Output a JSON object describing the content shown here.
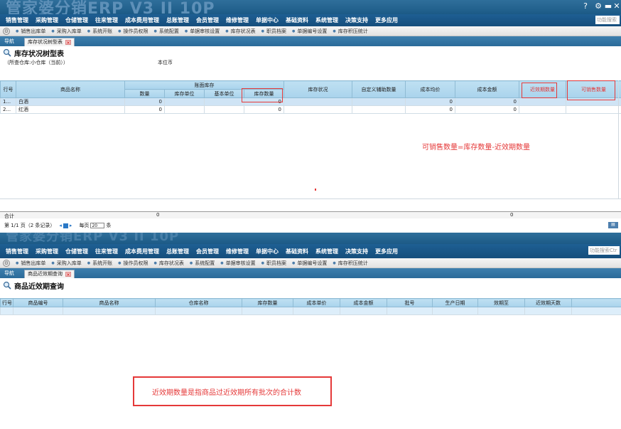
{
  "app": {
    "brand": "管家婆分销ERP V3 II 10P"
  },
  "menus": [
    "销售管理",
    "采购管理",
    "仓储管理",
    "往来管理",
    "成本费用管理",
    "总账管理",
    "会员管理",
    "维修管理",
    "单据中心",
    "基础资料",
    "系统管理",
    "决策支持",
    "更多应用"
  ],
  "search_placeholder": "功能搜索",
  "search_placeholder_2": "功能搜索Ctr",
  "quick_top": [
    "销售出库单",
    "采购入库单",
    "系统开账",
    "操作员权限",
    "系统配置",
    "单据审核设置",
    "库存状况表",
    "职员档案",
    "单据编号设置",
    "库存积压统计"
  ],
  "quick_bottom": [
    "销售出库单",
    "采购入库单",
    "系统开账",
    "操作员权限",
    "库存状况表",
    "系统配置",
    "单据审核设置",
    "职员档案",
    "单据编号设置",
    "库存积压统计"
  ],
  "nav_label": "导航",
  "top": {
    "tab": "库存状况树型表",
    "title": "库存状况树型表",
    "warehouse": "（所查仓库:小仓库（当前））",
    "currency": "本位币",
    "headers": {
      "row_no": "行号",
      "name": "商品名称",
      "group": "账面库存",
      "qty": "数量",
      "stock_unit": "库存单位",
      "base_unit": "基本单位",
      "stock_qty": "库存数量",
      "status": "库存状况",
      "aux_qty": "自定义辅助数量",
      "avg_cost": "成本均价",
      "cost_amount": "成本金额",
      "near_qty": "近效期数量",
      "sellable_qty": "可销售数量"
    },
    "rows": [
      {
        "no": "1...",
        "name": "白酒",
        "qty": "0",
        "stock_qty": "0",
        "avg_cost": "0",
        "cost_amount": "0"
      },
      {
        "no": "2...",
        "name": "红酒",
        "qty": "0",
        "stock_qty": "0",
        "avg_cost": "0",
        "cost_amount": "0"
      }
    ],
    "formula": "可销售数量=库存数量-近效期数量",
    "total_label": "合计",
    "total_qty": "0",
    "total_amount": "0",
    "pager_text": "第 1/1 页（2 条记录）",
    "per_page_label": "每页",
    "per_page": "20",
    "per_page_unit": "条"
  },
  "bottom": {
    "tab": "商品近效期查询",
    "title": "商品近效期查询",
    "headers": [
      "行号",
      "商品编号",
      "商品名称",
      "仓库名称",
      "库存数量",
      "成本单价",
      "成本金额",
      "批号",
      "生产日期",
      "效期至",
      "近效期天数"
    ],
    "note": "近效期数量是指商品过近效期所有批次的合计数"
  },
  "colors": {
    "accent": "#1e5f93",
    "header": "#a9d3ec",
    "annotation": "#e53939"
  }
}
